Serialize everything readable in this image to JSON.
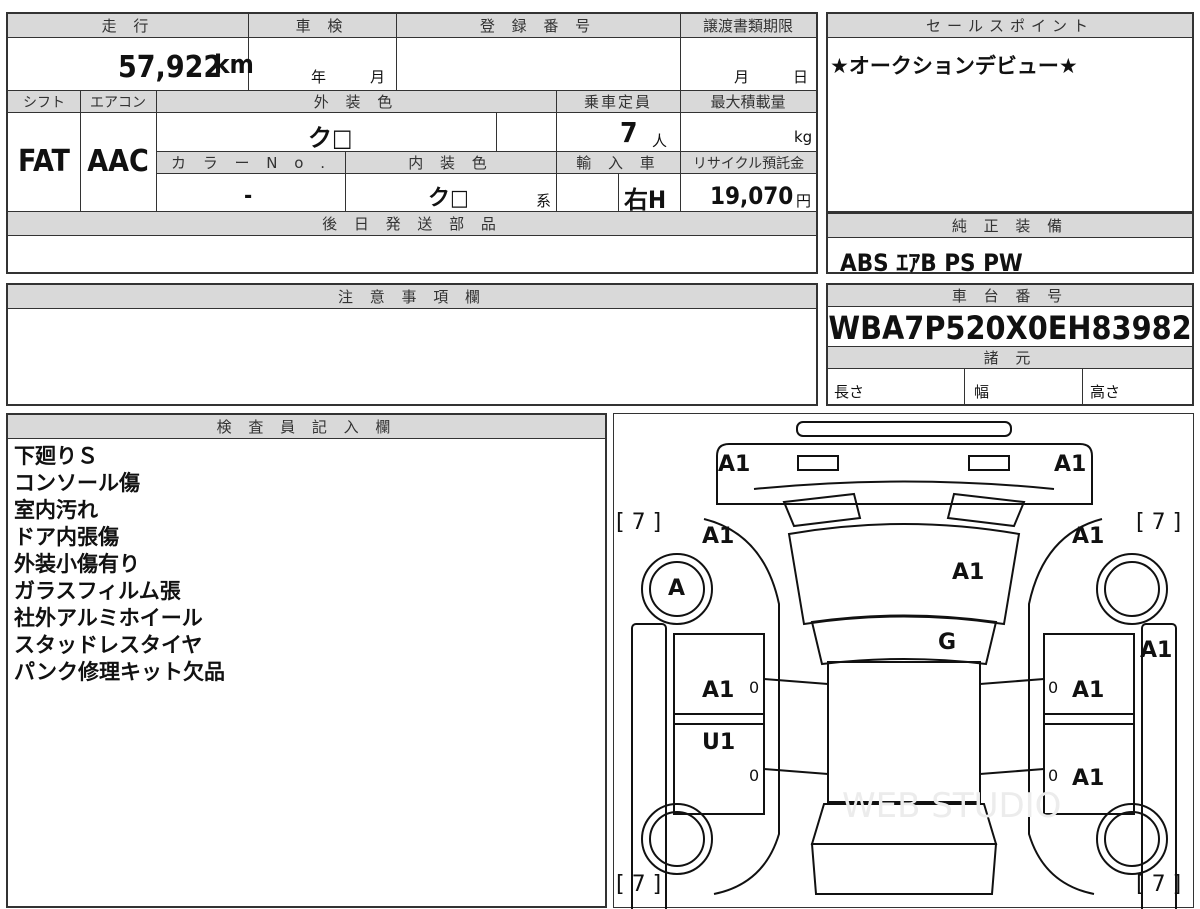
{
  "top_table": {
    "mileage_label": "走 行",
    "mileage": "57,922",
    "mileage_unit": "km",
    "inspection_label": "車 検",
    "inspection_year_unit": "年",
    "inspection_month_unit": "月",
    "registration_label": "登 録 番 号",
    "transfer_deadline_label": "譲渡書類期限",
    "transfer_month_unit": "月",
    "transfer_day_unit": "日",
    "shift_label": "シフト",
    "shift": "FAT",
    "ac_label": "エアコン",
    "ac": "AAC",
    "exterior_color_label": "外 装 色",
    "exterior_color": "ク□",
    "capacity_label": "乗車定員",
    "capacity": "7",
    "capacity_unit": "人",
    "max_load_label": "最大積載量",
    "max_load_unit": "kg",
    "color_no_label": "カ ラ ー N o .",
    "color_no": "-",
    "interior_color_label": "内 装 色",
    "interior_color": "ク□",
    "interior_suffix": "系",
    "import_label": "輸 入 車",
    "import_value": "右H",
    "recycle_label": "リサイクル預託金",
    "recycle_fee": "19,070",
    "recycle_unit": "円",
    "later_parts_label": "後 日 発 送 部 品"
  },
  "selling_points": {
    "label": "セールスポイント",
    "text": "★オークションデビュー★"
  },
  "factory_equipment": {
    "label": "純 正 装 備",
    "text": "ABS ｴｱB PS PW"
  },
  "notes": {
    "label": "注 意 事 項 欄"
  },
  "chassis": {
    "label": "車 台 番 号",
    "number": "WBA7P520X0EH83982",
    "specs_label": "諸 元",
    "length_label": "長さ",
    "width_label": "幅",
    "height_label": "高さ"
  },
  "inspector": {
    "label": "検 査 員 記 入 欄",
    "lines": [
      "下廻りＳ",
      "コンソール傷",
      "室内汚れ",
      "ドア内張傷",
      "外装小傷有り",
      "ガラスフィルム張",
      "社外アルミホイール",
      "スタッドレスタイヤ",
      "パンク修理キット欠品"
    ]
  },
  "diagram": {
    "codes": {
      "front_left_corner": "A1",
      "front_right_corner": "A1",
      "left_fender": "A1",
      "right_fender": "A1",
      "hood": "A1",
      "windshield": "G",
      "front_left_wheel": "A",
      "right_side": "A1",
      "front_left_door": "A1",
      "front_right_door": "A1",
      "rear_left_door": "U1",
      "rear_right_door": "A1"
    },
    "tire_depth": [
      "[ 7 ]",
      "[ 7 ]",
      "[ 7 ]",
      "[ 7 ]"
    ],
    "zero_marks": [
      "0",
      "0",
      "0",
      "0"
    ],
    "watermark": "WEB STUDIO"
  }
}
